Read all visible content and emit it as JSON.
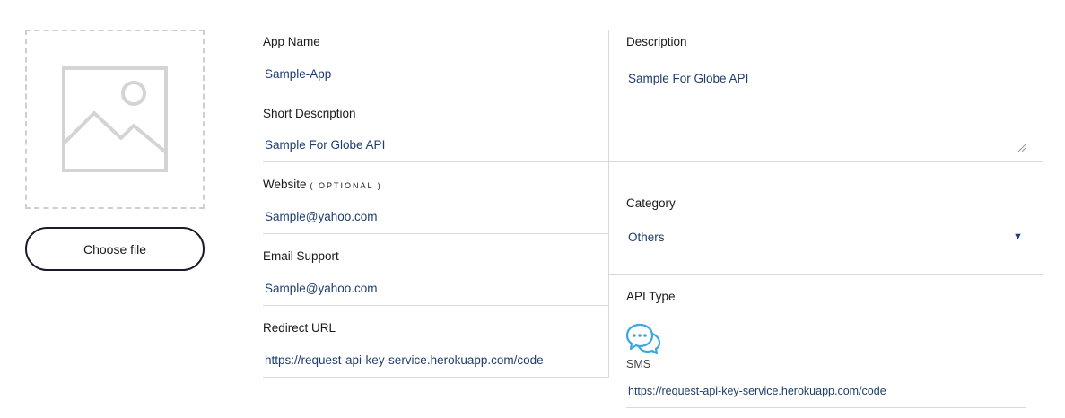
{
  "upload": {
    "button_label": "Choose file",
    "placeholder_icon": "image-placeholder-icon"
  },
  "fields": {
    "app_name": {
      "label": "App Name",
      "value": "Sample-App"
    },
    "short_description": {
      "label": "Short Description",
      "value": "Sample For Globe API"
    },
    "website": {
      "label": "Website",
      "optional": "( OPTIONAL )",
      "value": "Sample@yahoo.com"
    },
    "email_support": {
      "label": "Email Support",
      "value": "Sample@yahoo.com"
    },
    "redirect_url": {
      "label": "Redirect URL",
      "value": "https://request-api-key-service.herokuapp.com/code"
    }
  },
  "description": {
    "label": "Description",
    "value": "Sample For Globe API"
  },
  "category": {
    "label": "Category",
    "value": "Others",
    "caret": "▼"
  },
  "api_type": {
    "label": "API Type",
    "icon": "chat-bubbles-icon",
    "name": "SMS",
    "url": "https://request-api-key-service.herokuapp.com/code"
  },
  "colors": {
    "value_text": "#1e3d6e",
    "icon_blue": "#3aa6e6",
    "divider": "#d9d9d9",
    "button_border": "#1a1a2a"
  }
}
